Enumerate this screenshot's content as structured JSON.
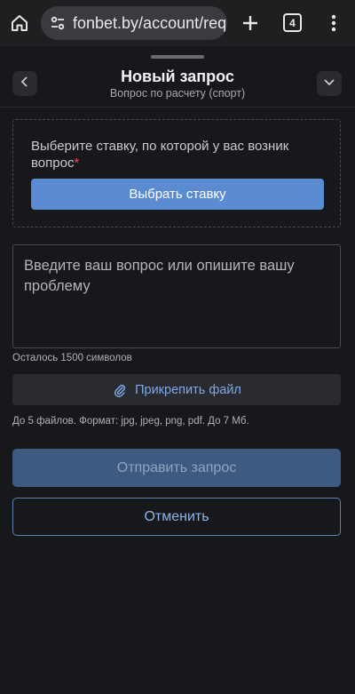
{
  "browser": {
    "url": "fonbet.by/account/requ",
    "tab_count": "4",
    "icons": [
      "home-icon",
      "site-settings-icon",
      "plus-icon",
      "tabs-icon",
      "more-vert-icon"
    ]
  },
  "header": {
    "title": "Новый запрос",
    "subtitle": "Вопрос по расчету (спорт)"
  },
  "bet_select": {
    "label": "Выберите ставку, по которой у вас возник вопрос",
    "required_mark": "*",
    "button_label": "Выбрать ставку"
  },
  "question": {
    "placeholder": "Введите ваш вопрос или опишите вашу проблему",
    "chars_left": "Осталось 1500 символов"
  },
  "attach": {
    "button_label": "Прикрепить файл",
    "hint": "До 5 файлов. Формат: jpg, jpeg, png, pdf. До 7 Мб."
  },
  "actions": {
    "submit_label": "Отправить запрос",
    "cancel_label": "Отменить"
  },
  "colors": {
    "background": "#17181c",
    "primary": "#5b8bd1",
    "primary_disabled": "#3f5a80",
    "link": "#7fa8e6",
    "required": "#e0524c"
  }
}
